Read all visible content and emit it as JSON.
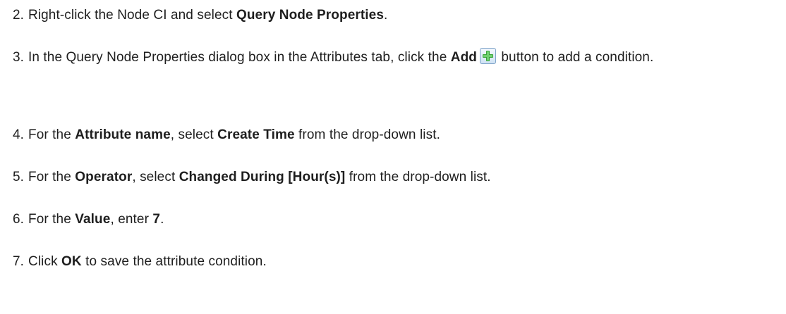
{
  "steps": [
    {
      "number": "2.",
      "parts": [
        "Right-click the Node CI and select ",
        "Query Node Properties",
        "."
      ]
    },
    {
      "number": "3.",
      "parts": [
        "In the Query Node Properties dialog box in the Attributes tab, click the ",
        "Add",
        " button to add a condition."
      ],
      "icon": "add-plus-icon",
      "icon_color": "#3aa33a"
    },
    {
      "number": "4.",
      "parts": [
        "For the ",
        "Attribute name",
        ", select ",
        "Create Time",
        " from the drop-down list."
      ]
    },
    {
      "number": "5.",
      "parts": [
        "For the ",
        "Operator",
        ", select ",
        "Changed During [Hour(s)]",
        " from the drop-down list."
      ]
    },
    {
      "number": "6.",
      "parts": [
        "For the ",
        "Value",
        ", enter ",
        "7",
        "."
      ]
    },
    {
      "number": "7.",
      "parts": [
        "Click ",
        "OK",
        " to save the attribute condition."
      ]
    }
  ]
}
